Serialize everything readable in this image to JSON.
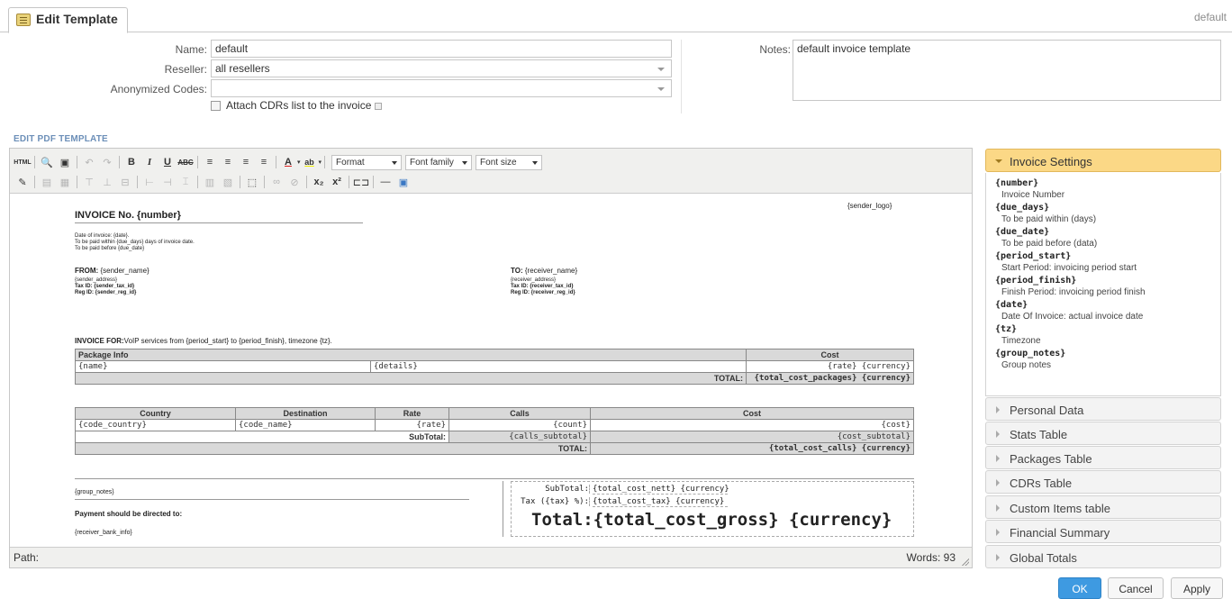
{
  "header": {
    "tab_title": "Edit Template",
    "right_label": "default"
  },
  "form": {
    "name_label": "Name:",
    "name_value": "default",
    "reseller_label": "Reseller:",
    "reseller_value": "all resellers",
    "anon_label": "Anonymized Codes:",
    "anon_value": "",
    "attach_label": "Attach CDRs list to the invoice",
    "notes_label": "Notes:",
    "notes_value": "default invoice template"
  },
  "section_title": "EDIT PDF TEMPLATE",
  "toolbar": {
    "format": "Format",
    "font_family": "Font family",
    "font_size": "Font size"
  },
  "doc": {
    "sender_logo": "{sender_logo}",
    "title": "INVOICE No. {number}",
    "date_line1": "Date of invoice: {date}.",
    "date_line2": "To be paid within {due_days} days of invoice date.",
    "date_line3": "To be paid before {due_date}",
    "from_label": "FROM:",
    "from_name": "{sender_name}",
    "from_addr": "{sender_address}",
    "from_tax": "Tax ID: {sender_tax_id}",
    "from_reg": "Reg ID: {sender_reg_id}",
    "to_label": "TO:",
    "to_name": "{receiver_name}",
    "to_addr": "{receiver_address}",
    "to_tax": "Tax ID: {receiver_tax_id}",
    "to_reg": "Reg ID: {receiver_reg_id}",
    "invoice_for_label": "INVOICE FOR:",
    "invoice_for_text": "VoIP services from {period_start} to {period_finish}, timezone {tz}.",
    "pkg": {
      "h1": "Package Info",
      "h2": "Cost",
      "name": "{name}",
      "details": "{details}",
      "rate": "{rate} {currency}",
      "total_label": "TOTAL:",
      "total_value": "{total_cost_packages} {currency}"
    },
    "calls": {
      "headers": [
        "Country",
        "Destination",
        "Rate",
        "Calls",
        "Cost"
      ],
      "row": [
        "{code_country}",
        "{code_name}",
        "{rate}",
        "{count}",
        "{cost}"
      ],
      "subtotal_label": "SubTotal:",
      "calls_subtotal": "{calls_subtotal}",
      "cost_subtotal": "{cost_subtotal}",
      "total_label": "TOTAL:",
      "total_value": "{total_cost_calls} {currency}"
    },
    "group_notes": "{group_notes}",
    "payment_label": "Payment should be directed to:",
    "bank_info": "{receiver_bank_info}",
    "sum": {
      "subtotal_label": "SubTotal:",
      "subtotal_value": "{total_cost_nett} {currency}",
      "tax_label": "Tax ({tax} %):",
      "tax_value": "{total_cost_tax} {currency}",
      "total_label": "Total:",
      "total_value": "{total_cost_gross} {currency}"
    }
  },
  "pathbar": {
    "path_label": "Path:",
    "words": "Words: 93"
  },
  "sidebar": {
    "open_title": "Invoice Settings",
    "vars": [
      {
        "key": "{number}",
        "desc": "Invoice Number"
      },
      {
        "key": "{due_days}",
        "desc": "To be paid within (days)"
      },
      {
        "key": "{due_date}",
        "desc": "To be paid before (data)"
      },
      {
        "key": "{period_start}",
        "desc": "Start Period: invoicing period start"
      },
      {
        "key": "{period_finish}",
        "desc": "Finish Period: invoicing period finish"
      },
      {
        "key": "{date}",
        "desc": "Date Of Invoice: actual invoice date"
      },
      {
        "key": "{tz}",
        "desc": "Timezone"
      },
      {
        "key": "{group_notes}",
        "desc": "Group notes"
      }
    ],
    "sections": [
      "Personal Data",
      "Stats Table",
      "Packages Table",
      "CDRs Table",
      "Custom Items table",
      "Financial Summary",
      "Global Totals"
    ]
  },
  "buttons": {
    "ok": "OK",
    "cancel": "Cancel",
    "apply": "Apply"
  }
}
